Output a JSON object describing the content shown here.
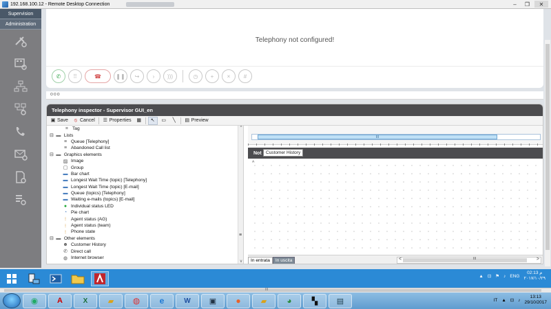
{
  "rdp": {
    "title": "192.168.100.12 - Remote Desktop Connection",
    "min_label": "–",
    "max_label": "❐",
    "close_label": "✕"
  },
  "leftnav": {
    "tabs": [
      {
        "label": "Supervision"
      },
      {
        "label": "Administration"
      }
    ],
    "icons": [
      "tools-gear-icon",
      "panel-gear-icon",
      "org-chart-icon",
      "network-gear-icon",
      "phone-gear-icon",
      "mail-gear-icon",
      "document-gear-icon",
      "tasks-gear-icon"
    ]
  },
  "telephony": {
    "message": "Telephony not configured!",
    "buttons": [
      "answer-call",
      "keypad",
      "hang-up",
      "hold",
      "transfer",
      "consult-transfer",
      "conference",
      "timer",
      "add-call",
      "remove-call",
      "dtmf"
    ]
  },
  "dots_label": "ooo",
  "inspector": {
    "title": "Telephony inspector - Supervisor GUI_en",
    "toolbar": {
      "save": "Save",
      "cancel": "Cancel",
      "properties": "Properties",
      "preview": "Preview"
    },
    "tree": [
      {
        "label": "Tag",
        "level": 2,
        "icon": "tag",
        "expander": ""
      },
      {
        "label": "Lists",
        "level": 0,
        "icon": "folder",
        "expander": "⊟"
      },
      {
        "label": "Queue [Telephony]",
        "level": 1,
        "icon": "list",
        "expander": ""
      },
      {
        "label": "Abandoned Call list",
        "level": 1,
        "icon": "list",
        "expander": ""
      },
      {
        "label": "Graphics elements",
        "level": 0,
        "icon": "folder",
        "expander": "⊟"
      },
      {
        "label": "Image",
        "level": 1,
        "icon": "image",
        "expander": ""
      },
      {
        "label": "Group",
        "level": 1,
        "icon": "group",
        "expander": ""
      },
      {
        "label": "Bar chart",
        "level": 1,
        "icon": "bar",
        "expander": ""
      },
      {
        "label": "Longest Wait Time (topic) [Telephony]",
        "level": 1,
        "icon": "bar",
        "expander": ""
      },
      {
        "label": "Longest Wait Time (topic) [E-mail]",
        "level": 1,
        "icon": "bar",
        "expander": ""
      },
      {
        "label": "Queue (topics) [Telephony]",
        "level": 1,
        "icon": "bar",
        "expander": ""
      },
      {
        "label": "Waiting e-mails (topics) [E-mail]",
        "level": 1,
        "icon": "bar",
        "expander": ""
      },
      {
        "label": "Individual status LED",
        "level": 1,
        "icon": "led",
        "expander": ""
      },
      {
        "label": "Pie chart",
        "level": 1,
        "icon": "pie",
        "expander": ""
      },
      {
        "label": "Agent status (AG)",
        "level": 1,
        "icon": "status",
        "expander": ""
      },
      {
        "label": "Agent status (team)",
        "level": 1,
        "icon": "status",
        "expander": ""
      },
      {
        "label": "Phone state",
        "level": 1,
        "icon": "status",
        "expander": ""
      },
      {
        "label": "Other elements",
        "level": 0,
        "icon": "folder",
        "expander": "⊟"
      },
      {
        "label": "Customer History",
        "level": 1,
        "icon": "person",
        "expander": ""
      },
      {
        "label": "Direct call",
        "level": 1,
        "icon": "call",
        "expander": ""
      },
      {
        "label": "Internet browser",
        "level": 1,
        "icon": "globe",
        "expander": ""
      }
    ],
    "canvas": {
      "scroll_thumb": "III",
      "widget_header": "Not",
      "tooltip": "Customer History",
      "caret": "^",
      "tabs": [
        "In entrata",
        "In uscita"
      ],
      "scroll_left": "<",
      "scroll_right": ">",
      "scroll_mid": "III",
      "tree_up": "^",
      "tree_down": "v",
      "tree_grip": "≡"
    }
  },
  "remote_taskbar": {
    "apps": [
      "windows-start",
      "explorer-app",
      "powershell-app",
      "folder-app",
      "ipdcc-app"
    ],
    "lang": "ENG",
    "time": "02:13 م",
    "date": "٢٠١٧/١٠/٢٩"
  },
  "bottom_scroll_mid": "III",
  "local_taskbar": {
    "apps": [
      "chrome-ie-app",
      "pdf-app",
      "excel-app",
      "folder-sync-app",
      "chrome-app",
      "ie-app",
      "word-app",
      "rdp-app",
      "firefox-app",
      "folder-app",
      "globe-app",
      "snip-app",
      "remote-desktop-app"
    ],
    "lang": "IT",
    "time": "13:13",
    "date": "29/10/2017"
  },
  "colors": {
    "nav_bg": "#7d7d80",
    "header_dark": "#4c4c4f",
    "taskbar_blue": "#2b8ad6",
    "answer_green": "#39a64f",
    "hangup_red": "#d24a4a"
  }
}
